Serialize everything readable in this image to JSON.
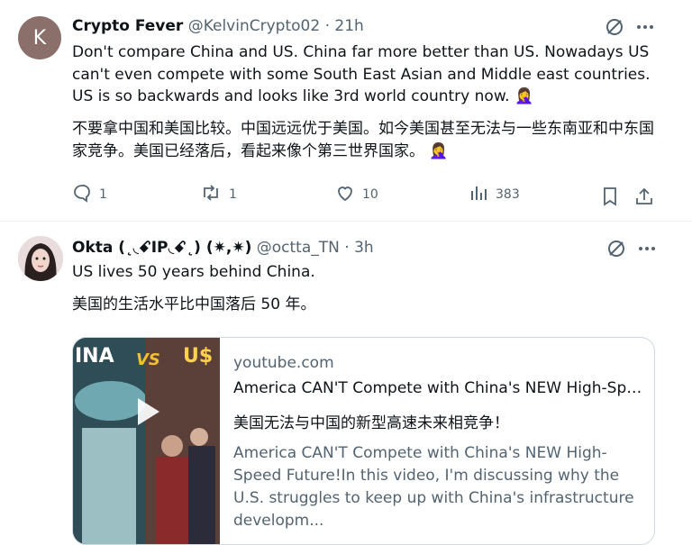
{
  "tweet1": {
    "avatar_letter": "K",
    "author_name": "Crypto Fever",
    "handle": "@KelvinCrypto02",
    "separator": "·",
    "time": "21h",
    "text_en": "Don't compare China and US. China far more better than US. Nowadays US can't even compete with some South East Asian and Middle east countries. US is so backwards and looks like 3rd world country now.",
    "text_zh": "不要拿中国和美国比较。中国远远优于美国。如今美国甚至无法与一些东南亚和中东国家竞争。美国已经落后，看起来像个第三世界国家。",
    "emoji": "🤦‍♀️",
    "actions": {
      "replies": "1",
      "retweets": "1",
      "likes": "10",
      "views": "383"
    }
  },
  "tweet2": {
    "author_name": "Okta (˛◟ꗃIP◟ꗃ˛) (✷,✷)",
    "handle": "@octta_TN",
    "separator": "·",
    "time": "3h",
    "text_en": "US lives 50 years behind China.",
    "text_zh": "美国的生活水平比中国落后 50 年。",
    "card": {
      "domain": "youtube.com",
      "title": "America CAN'T Compete with China's NEW High-Speed Future!",
      "title_zh": "美国无法与中国的新型高速未来相竞争！",
      "description": "America CAN'T Compete with China's NEW High-Speed Future!In this video, I'm discussing why the U.S. struggles to keep up with China's infrastructure developm...",
      "thumb_text_left": "INA",
      "thumb_text_vs": "VS",
      "thumb_text_right": "U$"
    }
  },
  "icons": [
    "grok-icon",
    "more-icon",
    "reply-icon",
    "retweet-icon",
    "like-icon",
    "views-icon",
    "bookmark-icon",
    "share-icon",
    "play-icon"
  ]
}
